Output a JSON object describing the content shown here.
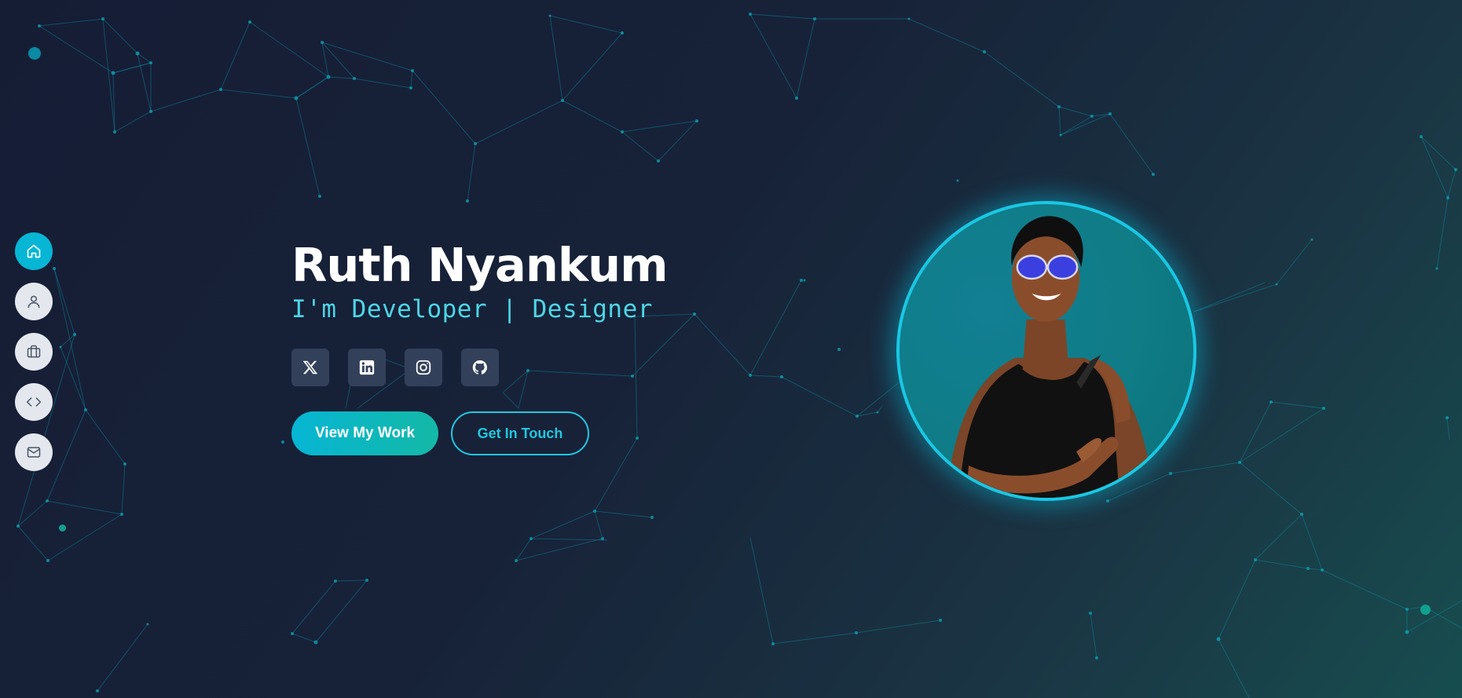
{
  "hero": {
    "name": "Ruth Nyankum",
    "role": "I'm Developer | Designer",
    "primary_cta": "View My Work",
    "secondary_cta": "Get In Touch"
  },
  "side_nav": [
    {
      "icon": "home-icon",
      "active": true
    },
    {
      "icon": "user-icon",
      "active": false
    },
    {
      "icon": "briefcase-icon",
      "active": false
    },
    {
      "icon": "code-icon",
      "active": false
    },
    {
      "icon": "mail-icon",
      "active": false
    }
  ],
  "socials": [
    {
      "icon": "x-twitter-icon"
    },
    {
      "icon": "linkedin-icon"
    },
    {
      "icon": "instagram-icon"
    },
    {
      "icon": "github-icon"
    }
  ],
  "colors": {
    "accent": "#06b6d4",
    "accent_teal": "#14b8a6",
    "role_text": "#4dd6e6",
    "background_dark": "#151d35",
    "nav_button": "#e4e8ee",
    "social_button": "#33405a"
  }
}
